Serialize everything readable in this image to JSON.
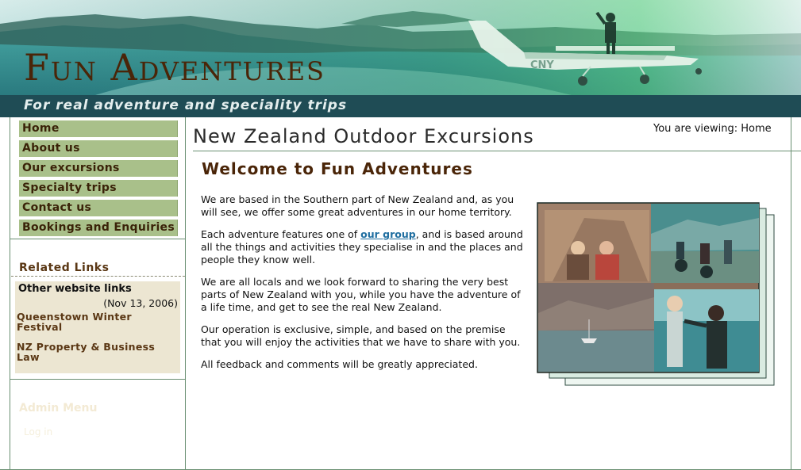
{
  "site": {
    "title": "Fun Adventures",
    "tagline": "For real adventure and speciality trips"
  },
  "nav": {
    "items": [
      {
        "label": "Home"
      },
      {
        "label": "About us"
      },
      {
        "label": "Our excursions"
      },
      {
        "label": "Specialty trips"
      },
      {
        "label": "Contact us"
      },
      {
        "label": "Bookings and Enquiries"
      }
    ]
  },
  "related": {
    "title": "Related Links",
    "box_title": "Other website links",
    "date": "(Nov 13, 2006)",
    "links": [
      {
        "label": "Queenstown Winter Festival"
      },
      {
        "label": "NZ Property & Business Law"
      }
    ]
  },
  "admin": {
    "title": "Admin Menu",
    "item": "Log in"
  },
  "main": {
    "breadcrumb": "You are viewing: Home",
    "page_title": "New Zealand Outdoor Excursions",
    "welcome": "Welcome to Fun Adventures",
    "p1": "We are based in the Southern part of New Zealand and, as you will see, we offer some great adventures in our home territory.",
    "p2_before": "Each adventure features one of ",
    "p2_link": "our group",
    "p2_after": ", and is based around all the things and activities they specialise in and the places and people they know well.",
    "p3": "We are all locals and we look forward to sharing the very best parts of New Zealand with you, while you have the adventure of a life time, and get to see the real New Zealand.",
    "p4": "Our operation is exclusive, simple, and based on the premise that you will enjoy the activities that we have to share with you.",
    "p5": "All feedback and comments will be greatly appreciated."
  },
  "banner_plane_registration": "CNY",
  "colors": {
    "nav_bg": "#a9c08a",
    "title_brown": "#4a2508",
    "tagline_bar": "#1f4c55",
    "link_blue": "#1f6ea0"
  }
}
